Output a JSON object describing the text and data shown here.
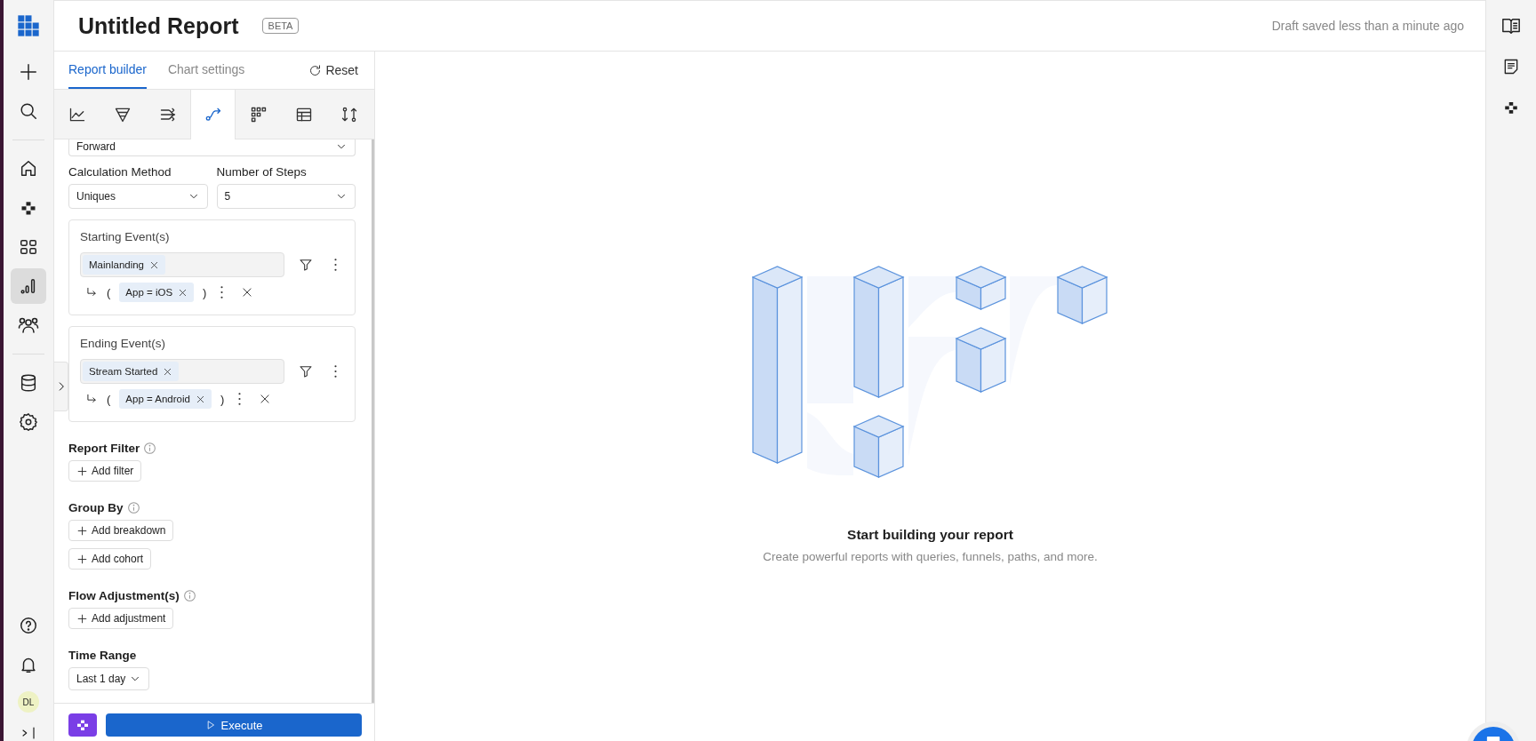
{
  "header": {
    "title": "Untitled Report",
    "badge": "BETA",
    "save_status": "Draft saved less than a minute ago"
  },
  "left_rail": {
    "top": [
      {
        "kind": "create",
        "selected": false
      },
      {
        "kind": "search",
        "selected": false
      }
    ],
    "main": [
      {
        "kind": "home",
        "selected": false
      },
      {
        "kind": "apps",
        "selected": false
      },
      {
        "kind": "dashboards",
        "selected": false
      },
      {
        "kind": "reports",
        "selected": true
      },
      {
        "kind": "cohorts",
        "selected": false
      }
    ],
    "admin": [
      {
        "kind": "data",
        "selected": false
      },
      {
        "kind": "settings",
        "selected": false
      }
    ],
    "bottom": [
      {
        "kind": "help"
      },
      {
        "kind": "notifications"
      }
    ],
    "avatar": "DL"
  },
  "panel": {
    "tabs": [
      {
        "label": "Report builder",
        "selected": true
      },
      {
        "label": "Chart settings",
        "selected": false
      }
    ],
    "reset": "Reset",
    "report_types": [
      {
        "kind": "line",
        "selected": false
      },
      {
        "kind": "funnel",
        "selected": false
      },
      {
        "kind": "flows",
        "selected": false
      },
      {
        "kind": "path",
        "selected": true
      },
      {
        "kind": "grid",
        "selected": false
      },
      {
        "kind": "table",
        "selected": false
      },
      {
        "kind": "compare",
        "selected": false
      }
    ],
    "direction": {
      "value": "Forward"
    },
    "calculation_method": {
      "label": "Calculation Method",
      "value": "Uniques"
    },
    "number_of_steps": {
      "label": "Number of Steps",
      "value": "5"
    },
    "event_groups": [
      {
        "title": "Starting Event(s)",
        "event": "Mainlanding",
        "filter": {
          "open": "(",
          "condition": "App = iOS",
          "close": ")"
        }
      },
      {
        "title": "Ending Event(s)",
        "event": "Stream Started",
        "filter": {
          "open": "(",
          "condition": "App = Android",
          "close": ")"
        }
      }
    ],
    "sections": [
      {
        "title": "Report Filter",
        "info": true,
        "buttons": [
          "Add filter"
        ]
      },
      {
        "title": "Group By",
        "info": true,
        "buttons": [
          "Add breakdown",
          "Add cohort"
        ]
      },
      {
        "title": "Flow Adjustment(s)",
        "info": true,
        "buttons": [
          "Add adjustment"
        ]
      }
    ],
    "time_range": {
      "title": "Time Range",
      "value": "Last 1 day"
    },
    "execute": "Execute"
  },
  "empty_state": {
    "title": "Start building your report",
    "subtitle": "Create powerful reports with queries, funnels, paths, and more."
  },
  "right_rail": [
    {
      "kind": "docs"
    },
    {
      "kind": "notes"
    },
    {
      "kind": "apps"
    }
  ]
}
